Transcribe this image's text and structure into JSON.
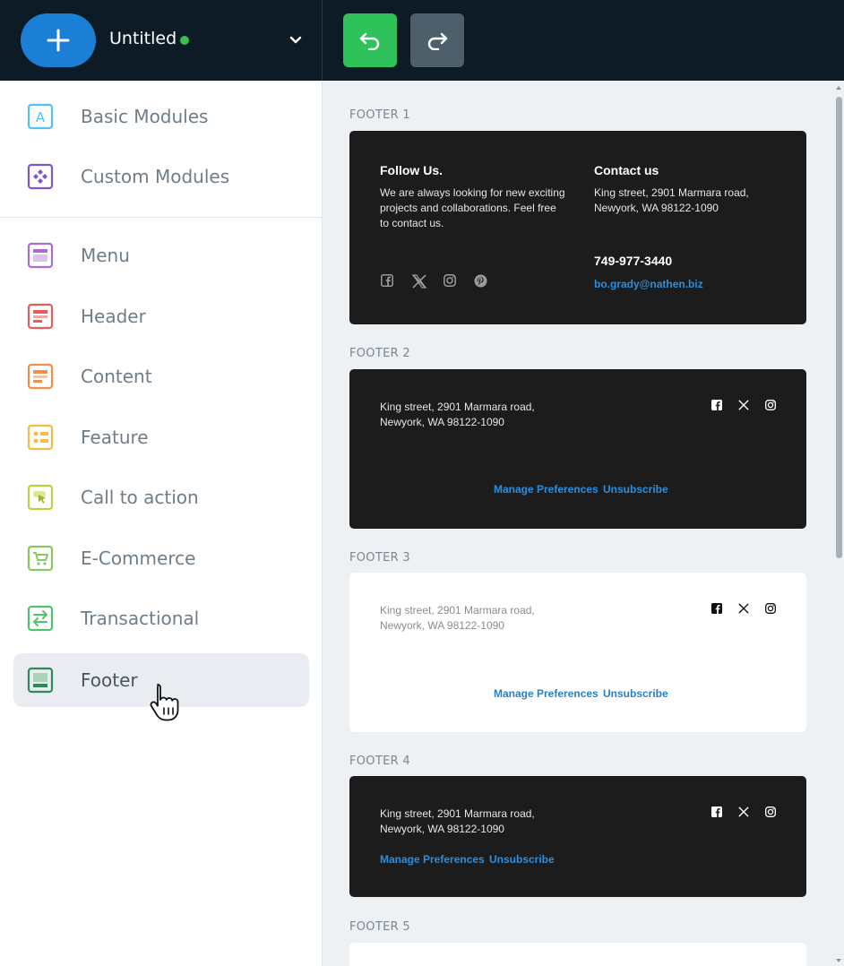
{
  "header": {
    "doc_title": "Untitled",
    "status_color": "#36c24a",
    "accent": "#1c7fd6"
  },
  "sidebar": {
    "items": [
      {
        "label": "Basic Modules",
        "icon": "letter-a-icon",
        "color": "#4fc3f7"
      },
      {
        "label": "Custom Modules",
        "icon": "components-icon",
        "color": "#7e57c2"
      },
      {
        "label": "Menu",
        "icon": "menu-layout-icon",
        "color": "#ab6bd6"
      },
      {
        "label": "Header",
        "icon": "header-layout-icon",
        "color": "#e35d5d"
      },
      {
        "label": "Content",
        "icon": "content-layout-icon",
        "color": "#f0904a"
      },
      {
        "label": "Feature",
        "icon": "feature-layout-icon",
        "color": "#f0c040"
      },
      {
        "label": "Call to action",
        "icon": "cursor-click-icon",
        "color": "#b9d43a"
      },
      {
        "label": "E-Commerce",
        "icon": "cart-icon",
        "color": "#86c95f"
      },
      {
        "label": "Transactional",
        "icon": "arrows-exchange-icon",
        "color": "#4fc36d"
      },
      {
        "label": "Footer",
        "icon": "footer-layout-icon",
        "color": "#2e8b57"
      }
    ],
    "active": "Footer"
  },
  "footers": [
    {
      "label": "FOOTER 1",
      "follow_title": "Follow Us.",
      "follow_text_1": "We are always looking for new exciting",
      "follow_text_2": "projects and collaborations. Feel free",
      "follow_text_3": "to contact us.",
      "contact_title": "Contact us",
      "address_1": "King street, 2901 Marmara road,",
      "address_2": "Newyork, WA 98122-1090",
      "phone": "749-977-3440",
      "email": "bo.grady@nathen.biz",
      "social_icons": [
        "facebook-icon",
        "x-icon",
        "instagram-icon",
        "pinterest-icon"
      ]
    },
    {
      "label": "FOOTER 2",
      "address_1": "King street, 2901 Marmara road,",
      "address_2": "Newyork, WA 98122-1090",
      "manage": "Manage Preferences",
      "unsubscribe": "Unsubscribe"
    },
    {
      "label": "FOOTER 3",
      "address_1": "King street, 2901 Marmara road,",
      "address_2": "Newyork, WA 98122-1090",
      "manage": "Manage Preferences",
      "unsubscribe": "Unsubscribe"
    },
    {
      "label": "FOOTER 4",
      "address_1": "King street, 2901 Marmara road,",
      "address_2": "Newyork, WA 98122-1090",
      "manage": "Manage Preferences",
      "unsubscribe": "Unsubscribe"
    },
    {
      "label": "FOOTER 5"
    }
  ]
}
